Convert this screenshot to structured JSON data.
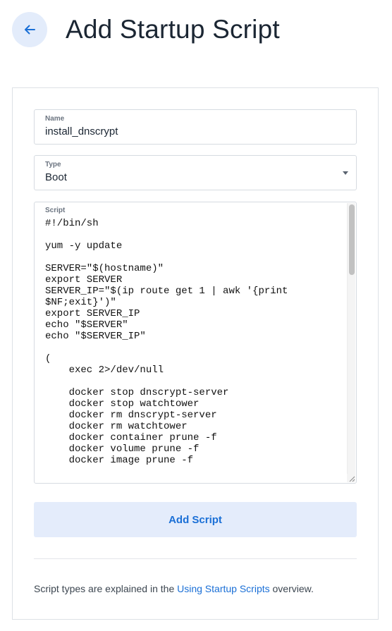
{
  "header": {
    "back_icon": "arrow-left-icon",
    "title": "Add Startup Script"
  },
  "form": {
    "name": {
      "label": "Name",
      "value": "install_dnscrypt"
    },
    "type": {
      "label": "Type",
      "value": "Boot",
      "caret_icon": "caret-down-icon"
    },
    "script": {
      "label": "Script",
      "lines": [
        "#!/bin/sh",
        "",
        "yum -y update",
        "",
        "SERVER=\"$(hostname)\"",
        "export SERVER",
        "SERVER_IP=\"$(ip route get 1 | awk '{print",
        "$NF;exit}')\"",
        "export SERVER_IP",
        "echo \"$SERVER\"",
        "echo \"$SERVER_IP\"",
        "",
        "(",
        "    exec 2>/dev/null",
        "",
        "    docker stop dnscrypt-server",
        "    docker stop watchtower",
        "    docker rm dnscrypt-server",
        "    docker rm watchtower",
        "    docker container prune -f",
        "    docker volume prune -f",
        "    docker image prune -f",
        ""
      ]
    },
    "submit_label": "Add Script"
  },
  "footer": {
    "prefix": "Script types are explained in the ",
    "link_text": "Using Startup Scripts",
    "suffix": " overview."
  },
  "colors": {
    "accent": "#1a6fd6",
    "button_bg": "#e4ecfb",
    "back_button_bg": "#e3ecfb",
    "border": "#d6dbe1"
  }
}
